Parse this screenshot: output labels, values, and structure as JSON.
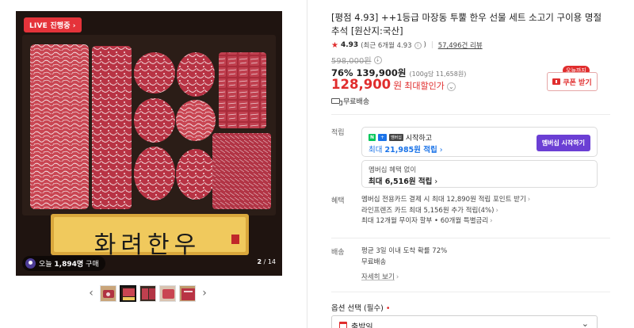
{
  "gallery": {
    "live_badge": "LIVE 진행중",
    "live_arrow": "›",
    "plaque_text": "화려한우",
    "buy_count_prefix": "오늘 ",
    "buy_count_num": "1,894명",
    "buy_count_suffix": " 구매",
    "page_current": "2",
    "page_total": " / 14",
    "prev": "‹",
    "next": "›"
  },
  "product": {
    "title": "[평점 4.93] ++1등급 마장동 투뿔 한우 선물 세트 소고기 구이용 명절 추석 [원산지:국산]",
    "score": "4.93",
    "score_note": "(최근 6개월 4.93",
    "review_count": "57,496건 리뷰",
    "original_price": "598,000원",
    "discount_pct": "76%",
    "discount_price": "139,900원",
    "unit_price": "(100g당 11,658원)",
    "max_discount_price": "128,900",
    "won": "원",
    "max_discount_label": "최대할인가",
    "coupon_tag": "오늘까지",
    "coupon_label": "쿠폰 받기",
    "free_shipping": "무료배송"
  },
  "points": {
    "label": "적립",
    "npay_n": "N",
    "npay_plus": "+",
    "npay_mem": "멤버십",
    "npay_start": "시작하고",
    "max_prefix": "최대 ",
    "max_value": "21,985원 적립",
    "max_chev": " ›",
    "member_button": "멤버십 시작하기",
    "nomember_title": "멤버십 혜택 없이",
    "nomember_value": "최대 6,516원 적립",
    "nomember_chev": " ›"
  },
  "benefits": {
    "label": "혜택",
    "items": [
      "멤버십 전용카드 결제 시 최대 12,890원 적립 포인트 받기",
      "라인프렌즈 카드 최대 5,156원 추가 적립(4%)",
      "최대 12개월 무이자 할부 • 60개월 특별금리"
    ]
  },
  "shipping": {
    "label": "배송",
    "arrival": "평균 3일 이내 도착 확률 72%",
    "fee": "무료배송",
    "detail": "자세히 보기"
  },
  "option": {
    "label": "옵션 선택 (필수)",
    "required_mark": " •",
    "selected": "출발일",
    "dropdown_icon": "chevron-down-icon"
  },
  "colors": {
    "accent_red": "#e02d2d",
    "npay_green": "#03c75a",
    "membership_purple": "#6b3fd4",
    "link_blue": "#1a73e8"
  }
}
